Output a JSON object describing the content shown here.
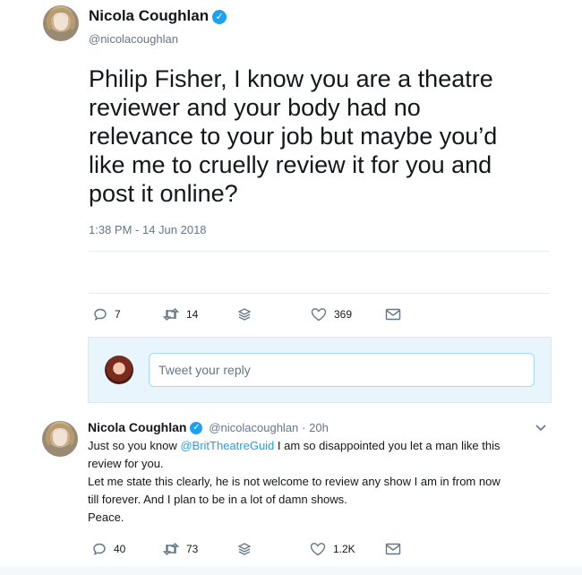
{
  "tweet": {
    "author_name": "Nicola Coughlan",
    "author_handle": "@nicolacoughlan",
    "text": "Philip Fisher, I know you are a theatre\nreviewer and your body had no\nrelevance to your job but maybe you’d\nlike me to cruelly review it for you and\npost it online?",
    "timestamp": "1:38 PM - 14 Jun 2018",
    "actions": {
      "reply_count": "7",
      "retweet_count": "14",
      "like_count": "369"
    }
  },
  "composer": {
    "placeholder": "Tweet your reply"
  },
  "reply": {
    "author_name": "Nicola Coughlan",
    "author_handle": "@nicolacoughlan",
    "time": "· 20h",
    "text_before_mention": "Just so you know ",
    "mention": "@BritTheatreGuid",
    "text_after_mention": " I am so disappointed you let a man like this\nreview for you.\nLet me state this clearly, he is not welcome to review any show I am in from now\ntill forever. And I plan to be in a lot of damn shows.\nPeace.",
    "actions": {
      "reply_count": "40",
      "retweet_count": "73",
      "like_count": "1.2K"
    }
  },
  "icons": [
    "reply-icon",
    "retweet-icon",
    "stack-icon",
    "heart-icon",
    "message-icon",
    "verified-badge-icon",
    "chevron-down-icon"
  ],
  "colors": {
    "accent": "#1da1f2",
    "muted": "#657786",
    "text": "#14171a"
  }
}
